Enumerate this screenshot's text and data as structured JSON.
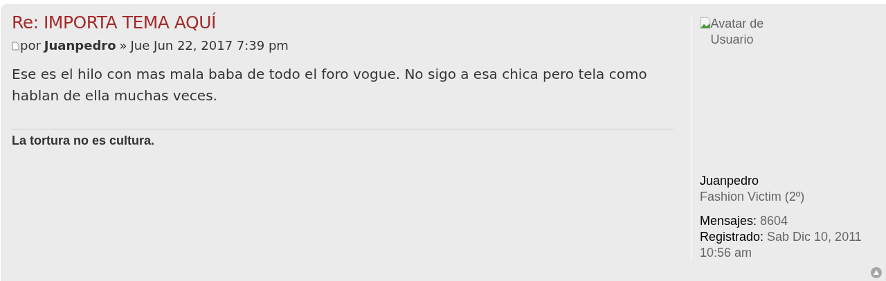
{
  "post": {
    "title": "Re: IMPORTA TEMA AQUÍ",
    "by_label": "por",
    "author": "Juanpedro",
    "separator": "»",
    "date": "Jue Jun 22, 2017 7:39 pm",
    "body": "Ese es el hilo con mas mala baba de todo el foro vogue. No sigo a esa chica pero tela como hablan de ella muchas veces.",
    "signature": "La tortura no es cultura."
  },
  "profile": {
    "avatar_alt": "Avatar de Usuario",
    "username": "Juanpedro",
    "rank": "Fashion Victim (2º)",
    "fields": [
      {
        "label": "Mensajes:",
        "value": "8604"
      },
      {
        "label": "Registrado:",
        "value": "Sab Dic 10, 2011 10:56 am"
      }
    ]
  }
}
